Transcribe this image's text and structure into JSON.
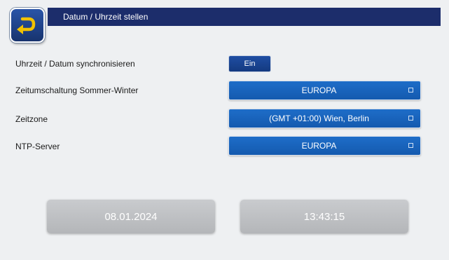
{
  "header": {
    "title": "Datum / Uhrzeit stellen",
    "back_icon": "return-arrow-icon"
  },
  "settings": {
    "sync": {
      "label": "Uhrzeit / Datum synchronisieren",
      "value": "Ein"
    },
    "dst": {
      "label": "Zeitumschaltung Sommer-Winter",
      "value": "EUROPA"
    },
    "timezone": {
      "label": "Zeitzone",
      "value": "(GMT +01:00) Wien, Berlin"
    },
    "ntp": {
      "label": "NTP-Server",
      "value": "EUROPA"
    }
  },
  "datetime": {
    "date": "08.01.2024",
    "time": "13:43:15"
  },
  "colors": {
    "title_bar": "#1c2d6b",
    "dropdown": "#1a66c0",
    "value_box": "#c0c2c5"
  }
}
